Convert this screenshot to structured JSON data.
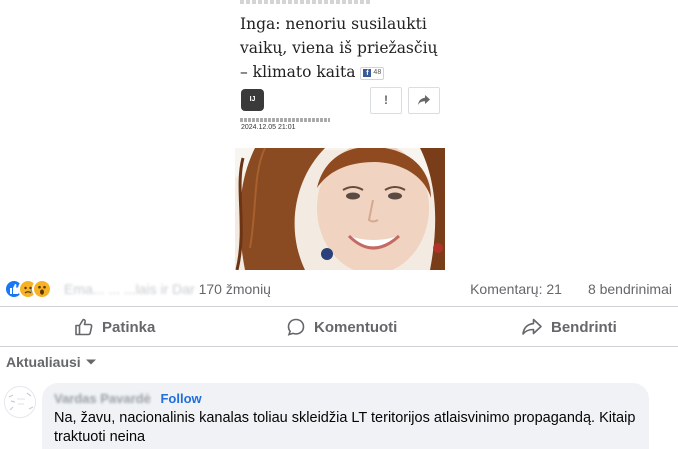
{
  "article": {
    "title": "Inga: nenoriu susilaukti vaikų, viena iš priežasčių – klimato kaita",
    "fb_share_count": "48",
    "author_initials": "IJ",
    "report_label": "!",
    "date": "2024.12.05 21:01"
  },
  "reactions": {
    "icons": [
      "like-icon",
      "sad-icon",
      "wow-icon"
    ],
    "names_blurred": "Ema... ... ...lais ir Dar",
    "others": "170 žmonių",
    "comments": "Komentarų: 21",
    "shares": "8 bendrinimai"
  },
  "actions": {
    "like": "Patinka",
    "comment": "Komentuoti",
    "share": "Bendrinti"
  },
  "sort": {
    "label": "Aktualiausi"
  },
  "comment": {
    "author_blurred": "Vardas Pavardė",
    "follow": "Follow",
    "text": "Na, žavu, nacionalinis kanalas toliau skleidžia LT teritorijos atlaisvinimo propagandą. Kitaip traktuoti neina"
  },
  "colors": {
    "facebook_blue": "#1877f2",
    "follow_blue": "#216fdb",
    "secondary_text": "#65676b",
    "comment_bubble": "#f0f2f5"
  }
}
